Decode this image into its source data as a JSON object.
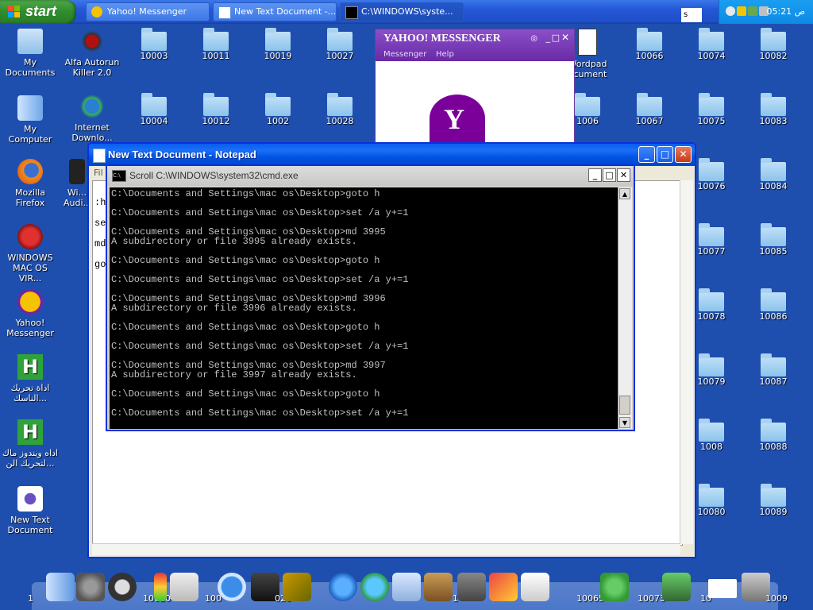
{
  "taskbar": {
    "start_label": "start",
    "tasks": [
      {
        "label": "Yahoo! Messenger"
      },
      {
        "label": "New Text Document -..."
      },
      {
        "label": "C:\\WINDOWS\\syste..."
      }
    ],
    "search_value": "s",
    "clock": "05:21 ص"
  },
  "desktop_left_icons": [
    {
      "label": "My Documents",
      "icon": "folder-docs-icon"
    },
    {
      "label": "My Computer",
      "icon": "finder-icon"
    },
    {
      "label": "Mozilla Firefox",
      "icon": "firefox-icon"
    },
    {
      "label": "WINDOWS MAC OS VIR...",
      "icon": "virus-icon"
    },
    {
      "label": "Yahoo! Messenger",
      "icon": "yahoo-icon"
    },
    {
      "label": "اداة تحريك الناسك...",
      "icon": "h-app-icon"
    },
    {
      "label": "اداه ويندوز ماك لتحريك الن...",
      "icon": "h-app-icon"
    },
    {
      "label": "New Text Document",
      "icon": "text-doc-icon"
    }
  ],
  "desktop_col2": [
    {
      "label": "Alfa Autorun Killer 2.0"
    },
    {
      "label": "Internet Downlo..."
    },
    {
      "label": "Wi... Audi..."
    }
  ],
  "folders_row1": [
    "10003",
    "10011",
    "10019",
    "10027"
  ],
  "folders_row2": [
    "10004",
    "10012",
    "1002",
    "10028"
  ],
  "right_col": {
    "row1": [
      "Wordpad ocument",
      "10066",
      "10074",
      "10082"
    ],
    "row2": [
      "1006",
      "10067",
      "10075",
      "10083"
    ],
    "c3": [
      "10076",
      "10077",
      "10078",
      "10079",
      "1008",
      "10080"
    ],
    "c4": [
      "10084",
      "10085",
      "10086",
      "10087",
      "10088",
      "10089"
    ]
  },
  "yahoo_window": {
    "logo": "YAHOO! MESSENGER",
    "menu": [
      "Messenger",
      "Help"
    ]
  },
  "notepad": {
    "title": "New Text Document - Notepad",
    "menu_first": "Fil",
    "lines": [
      ":h",
      "se",
      "md",
      "go"
    ]
  },
  "cmd": {
    "title": "Scroll C:\\WINDOWS\\system32\\cmd.exe",
    "output": "C:\\Documents and Settings\\mac os\\Desktop>goto h\n\nC:\\Documents and Settings\\mac os\\Desktop>set /a y+=1\n\nC:\\Documents and Settings\\mac os\\Desktop>md 3995\nA subdirectory or file 3995 already exists.\n\nC:\\Documents and Settings\\mac os\\Desktop>goto h\n\nC:\\Documents and Settings\\mac os\\Desktop>set /a y+=1\n\nC:\\Documents and Settings\\mac os\\Desktop>md 3996\nA subdirectory or file 3996 already exists.\n\nC:\\Documents and Settings\\mac os\\Desktop>goto h\n\nC:\\Documents and Settings\\mac os\\Desktop>set /a y+=1\n\nC:\\Documents and Settings\\mac os\\Desktop>md 3997\nA subdirectory or file 3997 already exists.\n\nC:\\Documents and Settings\\mac os\\Desktop>goto h\n\nC:\\Documents and Settings\\mac os\\Desktop>set /a y+=1"
  },
  "dock_labels": [
    "1",
    "10010",
    "100",
    "026",
    "10065",
    "10073",
    "10",
    "1009"
  ]
}
